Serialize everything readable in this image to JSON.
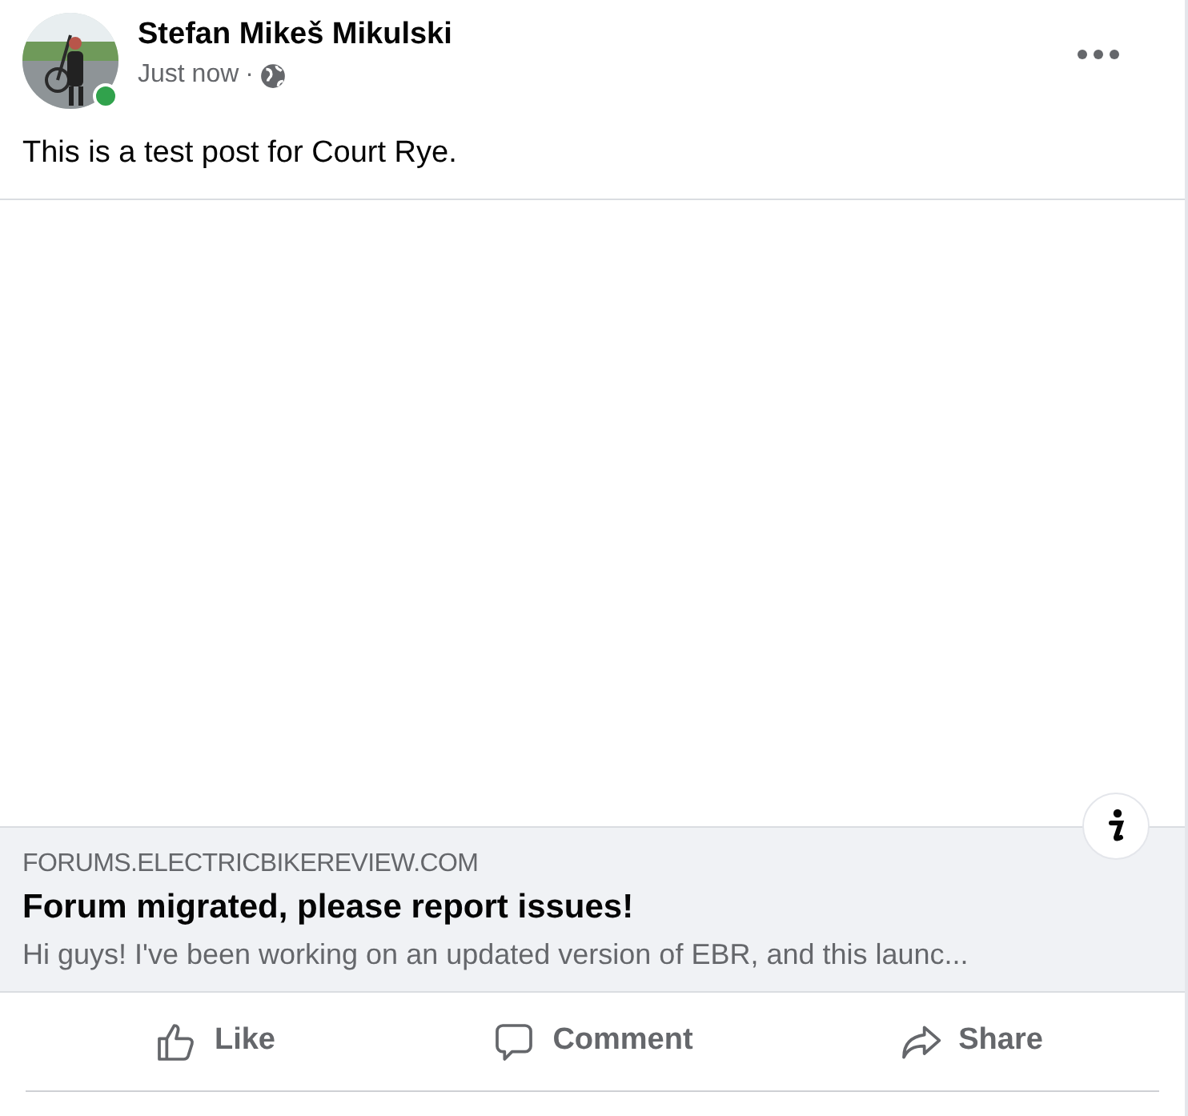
{
  "author": {
    "name": "Stefan Mikeš Mikulski",
    "online": true,
    "time": "Just now",
    "separator": "·"
  },
  "post_text": "This is a test post for Court Rye.",
  "link_preview": {
    "domain": "FORUMS.ELECTRICBIKEREVIEW.COM",
    "title": "Forum migrated, please report issues!",
    "description": "Hi guys! I've been working on an updated version of EBR, and this launc..."
  },
  "actions": [
    {
      "kind": "like",
      "label": "Like"
    },
    {
      "kind": "comment",
      "label": "Comment"
    },
    {
      "kind": "share",
      "label": "Share"
    }
  ]
}
